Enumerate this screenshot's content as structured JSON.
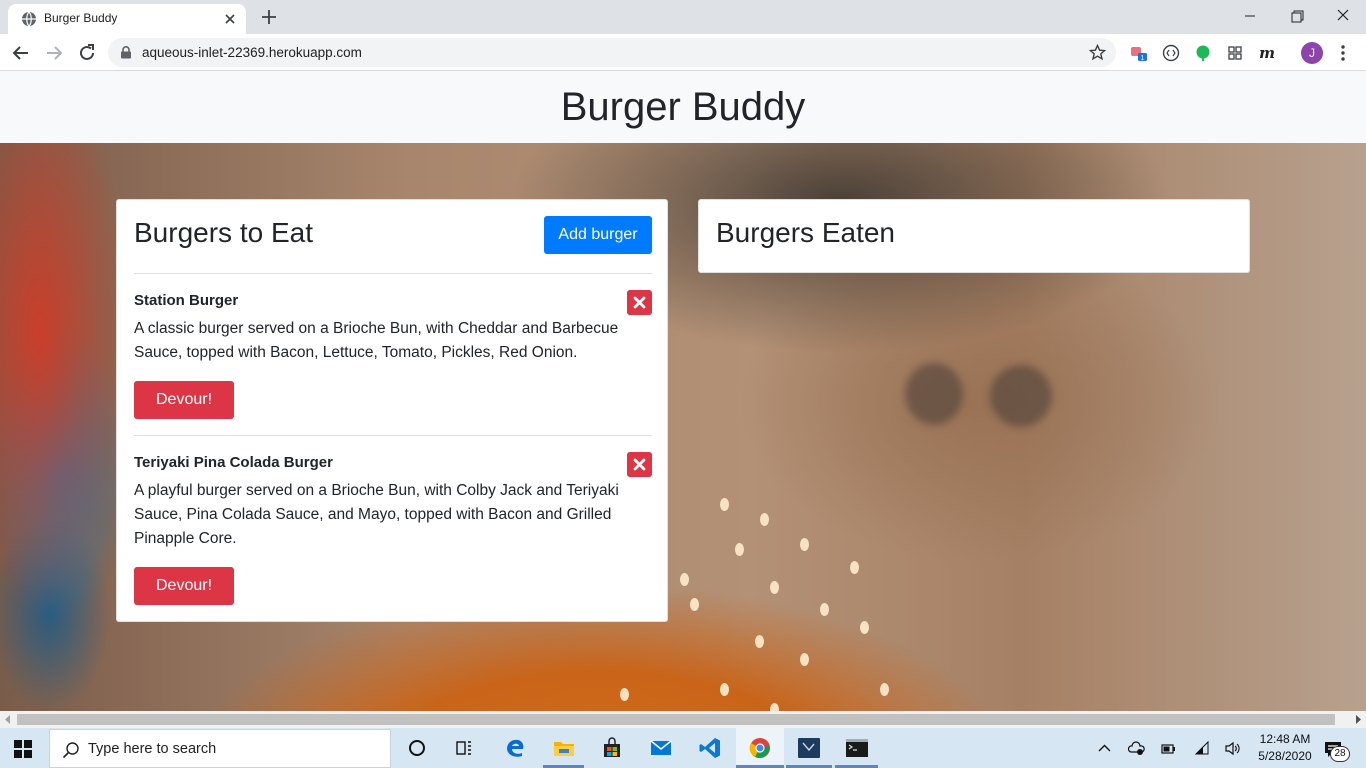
{
  "browser": {
    "tab_title": "Burger Buddy",
    "url": "aqueous-inlet-22369.herokuapp.com",
    "profile_initial": "J",
    "extension_badge": "1"
  },
  "site": {
    "title": "Burger Buddy"
  },
  "to_eat": {
    "heading": "Burgers to Eat",
    "add_button": "Add burger",
    "burgers": [
      {
        "name": "Station Burger",
        "description_lines": [
          "A classic burger served on a Brioche Bun, with Cheddar and Barbecue",
          "Sauce, topped with Bacon, Lettuce, Tomato, Pickles, Red Onion."
        ],
        "devour_label": "Devour!"
      },
      {
        "name": "Teriyaki Pina Colada Burger",
        "description_lines": [
          "A playful burger served on a Brioche Bun, with Colby Jack and Teriyaki",
          "Sauce, Pina Colada Sauce, and Mayo, topped with Bacon and Grilled",
          "Pinapple Core."
        ],
        "devour_label": "Devour!"
      }
    ]
  },
  "eaten": {
    "heading": "Burgers Eaten"
  },
  "taskbar": {
    "search_placeholder": "Type here to search",
    "time": "12:48 AM",
    "date": "5/28/2020",
    "notification_count": "28"
  },
  "colors": {
    "primary": "#007bff",
    "danger": "#dc3545",
    "header_bg": "#f8f9fa"
  }
}
